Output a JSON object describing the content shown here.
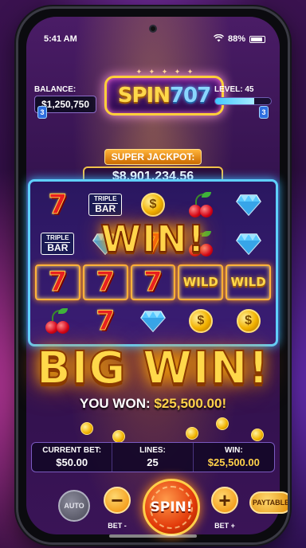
{
  "status_bar": {
    "time": "5:41 AM",
    "battery": "88%",
    "battery_level": 0.88,
    "icons": [
      "wifi-icon",
      "battery-icon"
    ]
  },
  "header": {
    "balance_label": "BALANCE:",
    "balance_value": "$1,250,750",
    "logo_part1": "SPIN",
    "logo_part2": "707",
    "level_label": "LEVEL: 45",
    "level_progress": 0.7
  },
  "jackpot": {
    "label": "SUPER JACKPOT:",
    "value": "$8,901,234.56"
  },
  "reels": {
    "grid": [
      [
        "seven",
        "triple-bar",
        "coin",
        "cherry",
        "diamond"
      ],
      [
        "triple-bar",
        "diamond",
        "seven",
        "cherry",
        "diamond"
      ],
      [
        "seven",
        "seven",
        "seven",
        "wild",
        "wild"
      ],
      [
        "cherry",
        "seven",
        "diamond",
        "coin",
        "coin"
      ]
    ],
    "winning_row": 2,
    "bar_top": "TRIPLE",
    "bar_bottom": "BAR",
    "seven_label": "7",
    "wild_label": "WILD",
    "coin_label": "$",
    "payline_left": "3",
    "payline_right": "3"
  },
  "win_banner": "WIN!",
  "big_win": "BIG WIN!",
  "you_won": {
    "label": "YOU WON:",
    "amount": "$25,500.00!"
  },
  "bet_info": {
    "current_bet_label": "CURRENT BET:",
    "current_bet_value": "$50.00",
    "lines_label": "LINES:",
    "lines_value": "25",
    "win_label": "WIN:",
    "win_value": "$25,500.00"
  },
  "controls": {
    "auto_label": "AUTO",
    "minus_label": "−",
    "bet_minus_label": "BET -",
    "spin_label": "SPIN!",
    "plus_label": "+",
    "bet_plus_label": "BET +",
    "paytable_label": "PAYTABLE"
  },
  "colors": {
    "gold": "#ffd24a",
    "accent_blue": "#5fd0ff",
    "spin_red": "#e23a0a"
  }
}
